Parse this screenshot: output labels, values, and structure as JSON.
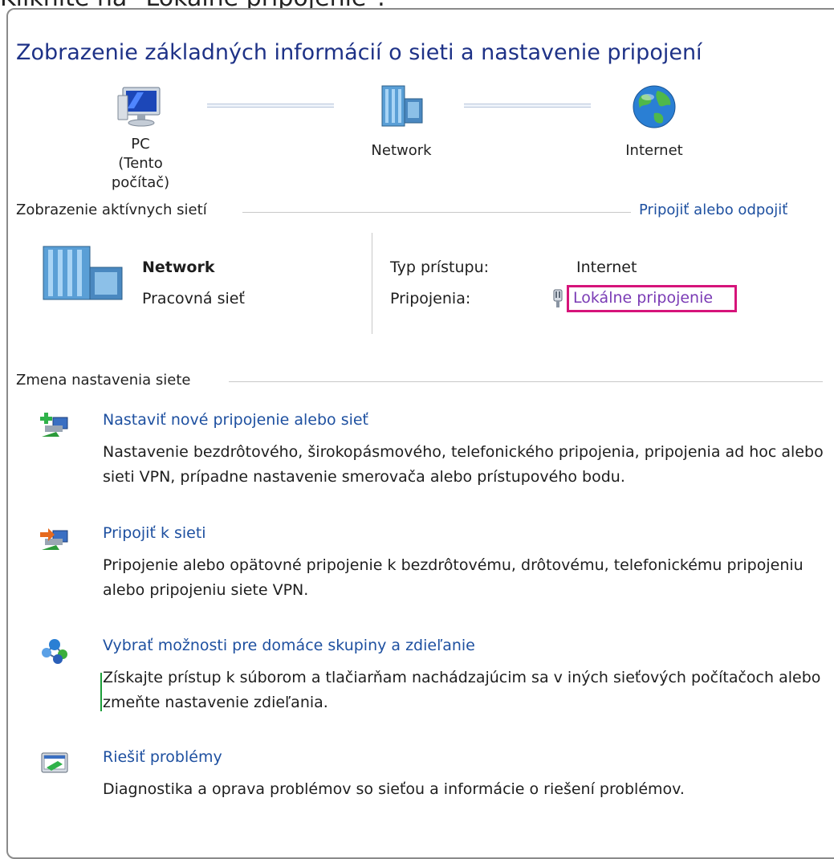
{
  "instruction": "Kliknite na \"Lokálne pripojenie\".",
  "page_title": "Zobrazenie základných informácií o sieti a nastavenie pripojení",
  "map": {
    "pc_label": "PC",
    "pc_sublabel": "(Tento počítač)",
    "network_label": "Network",
    "internet_label": "Internet"
  },
  "active_networks": {
    "heading": "Zobrazenie aktívnych sietí",
    "connect_link": "Pripojiť alebo odpojiť",
    "network_name": "Network",
    "network_type_link": "Pracovná sieť",
    "access_type_label": "Typ prístupu:",
    "access_type_value": "Internet",
    "connections_label": "Pripojenia:",
    "connection_link": "Lokálne pripojenie"
  },
  "change_settings": {
    "heading": "Zmena nastavenia siete",
    "tasks": [
      {
        "title": "Nastaviť nové pripojenie alebo sieť",
        "description": "Nastavenie bezdrôtového, širokopásmového, telefonického pripojenia, pripojenia ad hoc alebo sieti VPN, prípadne nastavenie smerovača alebo prístupového bodu.",
        "icon": "new-connection-icon"
      },
      {
        "title": "Pripojiť k sieti",
        "description": "Pripojenie alebo opätovné pripojenie k bezdrôtovému, drôtovému, telefonickému pripojeniu alebo pripojeniu siete VPN.",
        "icon": "connect-network-icon"
      },
      {
        "title": "Vybrať možnosti pre domáce skupiny a zdieľanie",
        "description": "Získajte prístup k súborom a tlačiarňam nachádzajúcim sa v iných sieťových počítačoch alebo zmeňte nastavenie zdieľania.",
        "icon": "homegroup-icon"
      },
      {
        "title": "Riešiť problémy",
        "description": "Diagnostika a oprava problémov so sieťou a informácie o riešení problémov.",
        "icon": "troubleshoot-icon"
      }
    ]
  },
  "colors": {
    "title": "#1e3287",
    "link": "#1e50a0",
    "highlight": "#d6147a"
  }
}
